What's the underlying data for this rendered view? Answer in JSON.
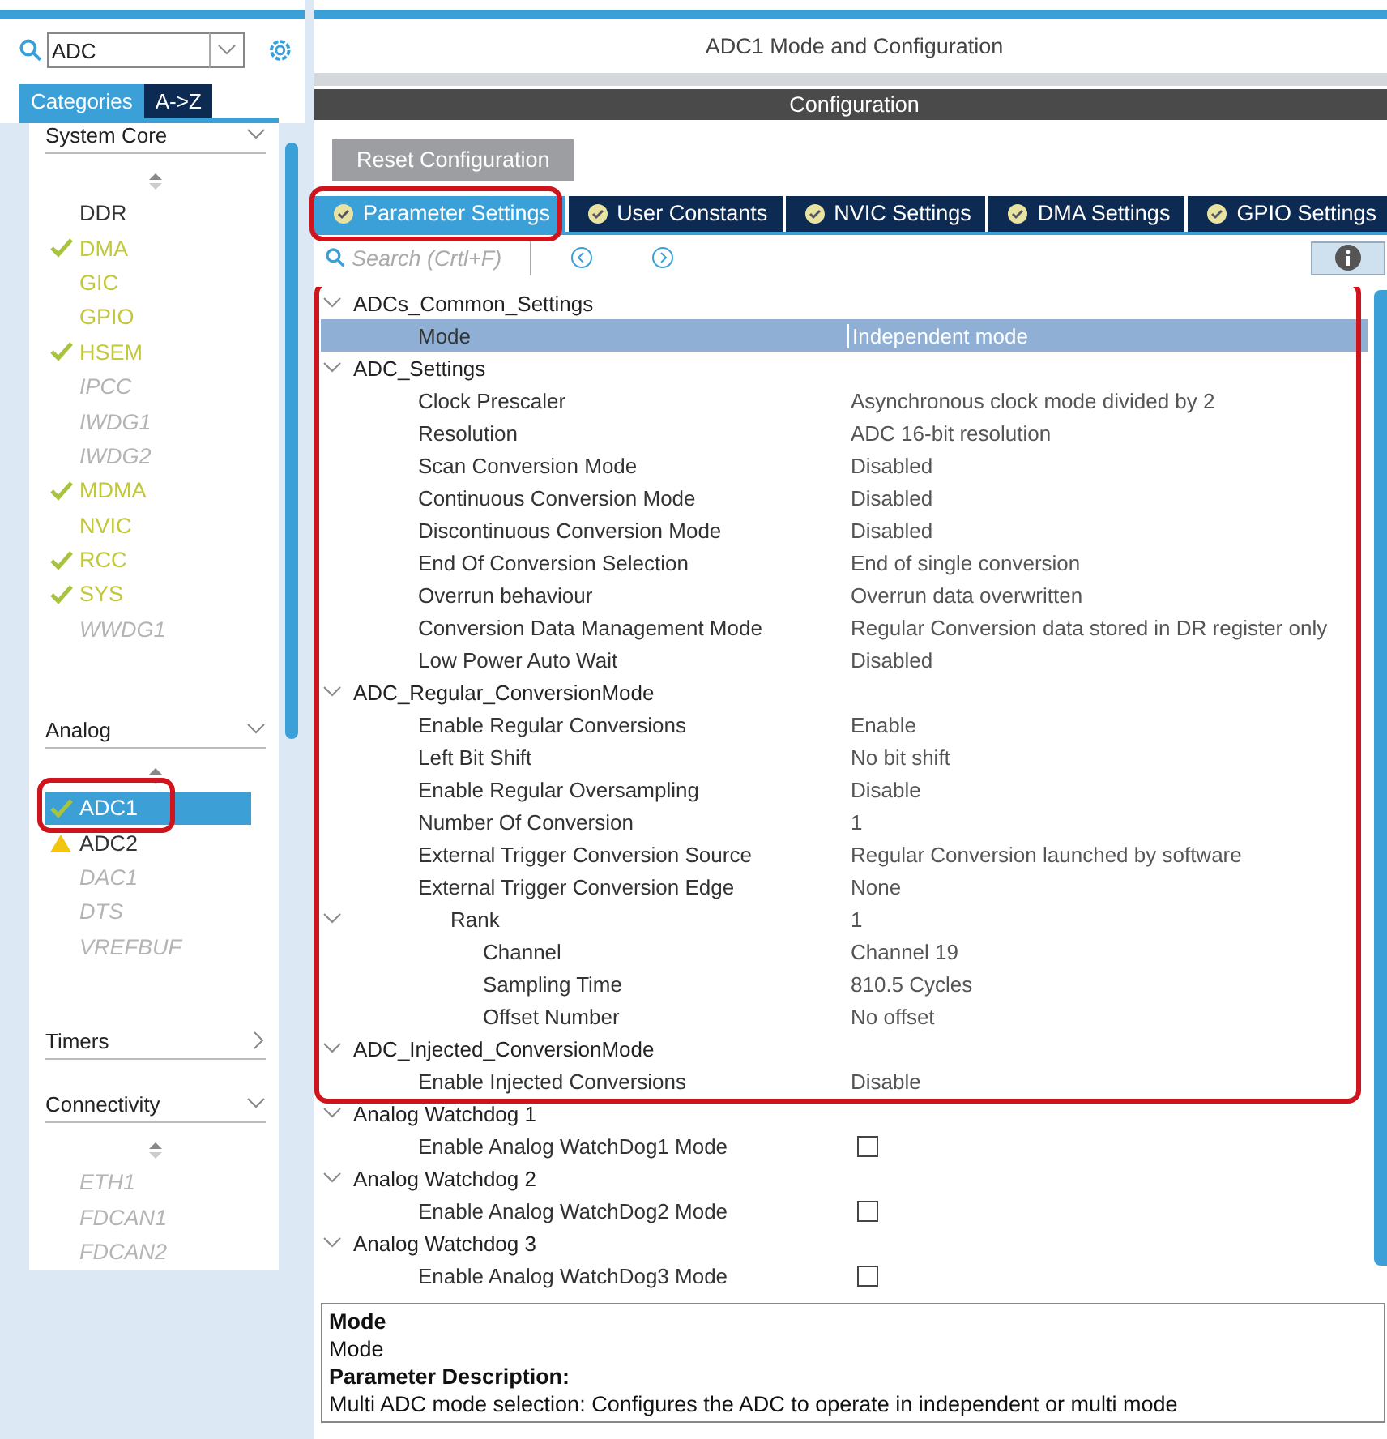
{
  "search": {
    "value": "ADC"
  },
  "view_tabs": [
    {
      "label": "Categories",
      "selected": true
    },
    {
      "label": "A->Z",
      "selected": false
    }
  ],
  "categories": [
    {
      "name": "System Core",
      "expanded": true,
      "items": [
        {
          "label": "DDR",
          "kind": "plain",
          "selected": false,
          "highlighted": false
        },
        {
          "label": "DMA",
          "kind": "configured",
          "selected": false,
          "highlighted": false
        },
        {
          "label": "GIC",
          "kind": "enabled",
          "selected": false,
          "highlighted": false
        },
        {
          "label": "GPIO",
          "kind": "enabled",
          "selected": false,
          "highlighted": false
        },
        {
          "label": "HSEM",
          "kind": "configured",
          "selected": false,
          "highlighted": false
        },
        {
          "label": "IPCC",
          "kind": "disabled",
          "selected": false,
          "highlighted": false
        },
        {
          "label": "IWDG1",
          "kind": "disabled",
          "selected": false,
          "highlighted": false
        },
        {
          "label": "IWDG2",
          "kind": "disabled",
          "selected": false,
          "highlighted": false
        },
        {
          "label": "MDMA",
          "kind": "configured",
          "selected": false,
          "highlighted": false
        },
        {
          "label": "NVIC",
          "kind": "enabled",
          "selected": false,
          "highlighted": false
        },
        {
          "label": "RCC",
          "kind": "configured",
          "selected": false,
          "highlighted": false
        },
        {
          "label": "SYS",
          "kind": "configured",
          "selected": false,
          "highlighted": false
        },
        {
          "label": "WWDG1",
          "kind": "disabled",
          "selected": false,
          "highlighted": false
        }
      ]
    },
    {
      "name": "Analog",
      "expanded": true,
      "items": [
        {
          "label": "ADC1",
          "kind": "configured",
          "selected": true,
          "highlighted": true
        },
        {
          "label": "ADC2",
          "kind": "warning",
          "selected": false,
          "highlighted": false
        },
        {
          "label": "DAC1",
          "kind": "disabled",
          "selected": false,
          "highlighted": false
        },
        {
          "label": "DTS",
          "kind": "disabled",
          "selected": false,
          "highlighted": false
        },
        {
          "label": "VREFBUF",
          "kind": "disabled",
          "selected": false,
          "highlighted": false
        }
      ]
    },
    {
      "name": "Timers",
      "expanded": false
    },
    {
      "name": "Connectivity",
      "expanded": true,
      "items": [
        {
          "label": "ETH1",
          "kind": "disabled",
          "selected": false,
          "highlighted": false
        },
        {
          "label": "FDCAN1",
          "kind": "disabled",
          "selected": false,
          "highlighted": false
        },
        {
          "label": "FDCAN2",
          "kind": "disabled",
          "selected": false,
          "highlighted": false
        }
      ]
    }
  ],
  "title": "ADC1 Mode and Configuration",
  "section_bar": "Configuration",
  "reset_button": "Reset Configuration",
  "tabs": [
    {
      "label": "Parameter Settings",
      "selected": true,
      "highlighted": true
    },
    {
      "label": "User Constants",
      "selected": false,
      "highlighted": false
    },
    {
      "label": "NVIC Settings",
      "selected": false,
      "highlighted": false
    },
    {
      "label": "DMA Settings",
      "selected": false,
      "highlighted": false
    },
    {
      "label": "GPIO Settings",
      "selected": false,
      "highlighted": false
    }
  ],
  "param_search": {
    "placeholder": "Search (Crtl+F)"
  },
  "tree": [
    {
      "label": "ADCs_Common_Settings",
      "kind": "group",
      "expanded": true,
      "highlighted": true,
      "children": [
        {
          "label": "Mode",
          "value": "Independent mode",
          "kind": "param",
          "selected": true
        }
      ]
    },
    {
      "label": "ADC_Settings",
      "kind": "group",
      "expanded": true,
      "highlighted": true,
      "children": [
        {
          "label": "Clock Prescaler",
          "value": "Asynchronous clock mode divided by 2",
          "kind": "param",
          "selected": false
        },
        {
          "label": "Resolution",
          "value": "ADC 16-bit resolution",
          "kind": "param",
          "selected": false
        },
        {
          "label": "Scan Conversion Mode",
          "value": "Disabled",
          "kind": "param",
          "selected": false
        },
        {
          "label": "Continuous Conversion Mode",
          "value": "Disabled",
          "kind": "param",
          "selected": false
        },
        {
          "label": "Discontinuous Conversion Mode",
          "value": "Disabled",
          "kind": "param",
          "selected": false
        },
        {
          "label": "End Of Conversion Selection",
          "value": "End of single conversion",
          "kind": "param",
          "selected": false
        },
        {
          "label": "Overrun behaviour",
          "value": "Overrun data overwritten",
          "kind": "param",
          "selected": false
        },
        {
          "label": "Conversion Data Management Mode",
          "value": "Regular Conversion data stored in DR register only",
          "kind": "param",
          "selected": false
        },
        {
          "label": "Low Power Auto Wait",
          "value": "Disabled",
          "kind": "param",
          "selected": false
        }
      ]
    },
    {
      "label": "ADC_Regular_ConversionMode",
      "kind": "group",
      "expanded": true,
      "highlighted": true,
      "children": [
        {
          "label": "Enable Regular Conversions",
          "value": "Enable",
          "kind": "param",
          "selected": false
        },
        {
          "label": "Left Bit Shift",
          "value": "No bit shift",
          "kind": "param",
          "selected": false
        },
        {
          "label": "Enable Regular Oversampling",
          "value": "Disable",
          "kind": "param",
          "selected": false
        },
        {
          "label": "Number Of Conversion",
          "value": "1",
          "kind": "param",
          "selected": false
        },
        {
          "label": "External Trigger Conversion Source",
          "value": "Regular Conversion launched by software",
          "kind": "param",
          "selected": false
        },
        {
          "label": "External Trigger Conversion Edge",
          "value": "None",
          "kind": "param",
          "selected": false
        },
        {
          "label": "Rank",
          "value": "1",
          "kind": "param",
          "selected": false,
          "expanded": true,
          "children": [
            {
              "label": "Channel",
              "value": "Channel 19",
              "kind": "param",
              "selected": false
            },
            {
              "label": "Sampling Time",
              "value": "810.5 Cycles",
              "kind": "param",
              "selected": false
            },
            {
              "label": "Offset Number",
              "value": "No offset",
              "kind": "param",
              "selected": false
            }
          ]
        }
      ]
    },
    {
      "label": "ADC_Injected_ConversionMode",
      "kind": "group",
      "expanded": true,
      "highlighted": true,
      "children": [
        {
          "label": "Enable Injected Conversions",
          "value": "Disable",
          "kind": "param",
          "selected": false
        }
      ]
    },
    {
      "label": "Analog Watchdog 1",
      "kind": "group",
      "expanded": true,
      "highlighted": false,
      "children": [
        {
          "label": "Enable Analog WatchDog1 Mode",
          "kind": "checkbox",
          "checked": false,
          "selected": false
        }
      ]
    },
    {
      "label": "Analog Watchdog 2",
      "kind": "group",
      "expanded": true,
      "highlighted": false,
      "children": [
        {
          "label": "Enable Analog WatchDog2 Mode",
          "kind": "checkbox",
          "checked": false,
          "selected": false
        }
      ]
    },
    {
      "label": "Analog Watchdog 3",
      "kind": "group",
      "expanded": true,
      "highlighted": false,
      "children": [
        {
          "label": "Enable Analog WatchDog3 Mode",
          "kind": "checkbox",
          "checked": false,
          "selected": false
        }
      ]
    }
  ],
  "description": {
    "title": "Mode",
    "name": "Mode",
    "heading": "Parameter Description:",
    "text": "Multi ADC mode selection: Configures the ADC to operate in independent or multi mode"
  }
}
